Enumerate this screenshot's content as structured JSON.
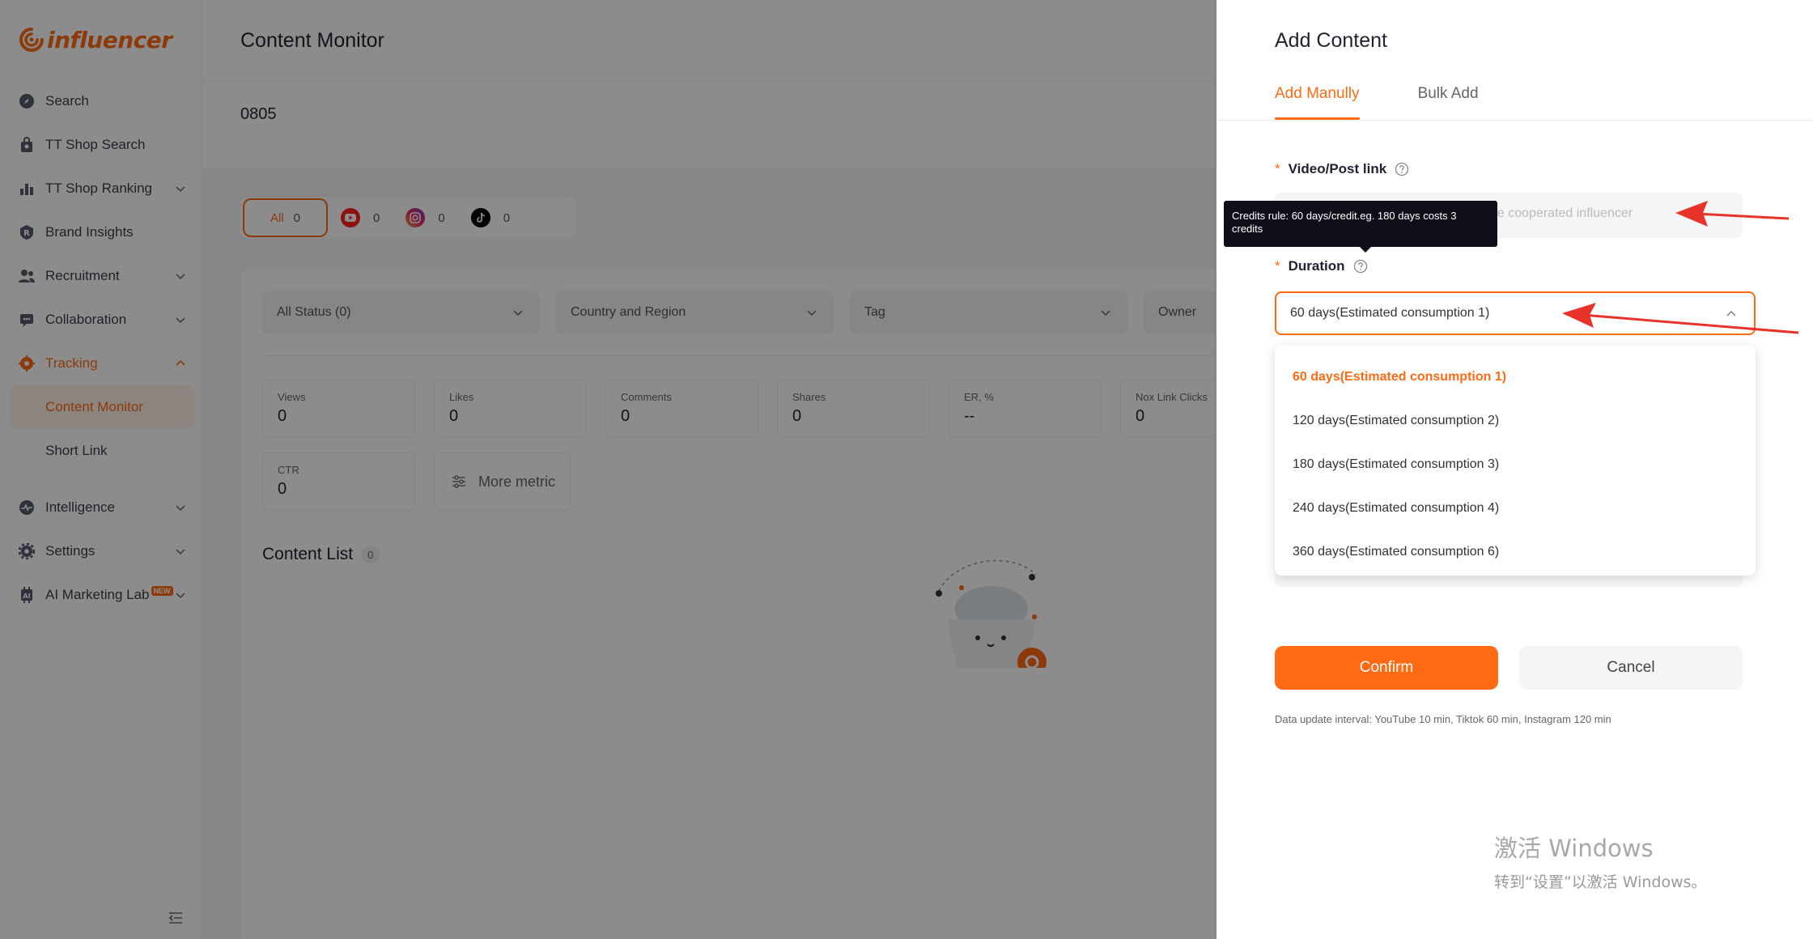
{
  "brand": {
    "logo_text": "influencer",
    "accent": "#ff6a13"
  },
  "sidebar": {
    "items": [
      {
        "label": "Search",
        "icon": "compass-icon"
      },
      {
        "label": "TT Shop Search",
        "icon": "shop-icon"
      },
      {
        "label": "TT Shop Ranking",
        "icon": "bar-chart-icon"
      },
      {
        "label": "Brand Insights",
        "icon": "brand-icon"
      },
      {
        "label": "Recruitment",
        "icon": "people-icon"
      },
      {
        "label": "Collaboration",
        "icon": "collaboration-icon"
      },
      {
        "label": "Tracking",
        "icon": "tracking-icon"
      },
      {
        "label": "Intelligence",
        "icon": "pulse-icon"
      },
      {
        "label": "Settings",
        "icon": "gear-icon"
      },
      {
        "label": "AI Marketing Lab",
        "icon": "ai-icon",
        "badge": "NEW"
      }
    ],
    "sub_items": [
      "Content Monitor",
      "Short Link"
    ]
  },
  "header": {
    "title": "Content Monitor",
    "project": "0805"
  },
  "platform_tabs": [
    {
      "label": "All",
      "count": "0"
    },
    {
      "label": "",
      "count": "0",
      "icon": "youtube-icon"
    },
    {
      "label": "",
      "count": "0",
      "icon": "instagram-icon"
    },
    {
      "label": "",
      "count": "0",
      "icon": "tiktok-icon"
    }
  ],
  "filters": [
    "All Status (0)",
    "Country and Region",
    "Tag",
    "Owner"
  ],
  "metrics": [
    {
      "label": "Views",
      "value": "0"
    },
    {
      "label": "Likes",
      "value": "0"
    },
    {
      "label": "Comments",
      "value": "0"
    },
    {
      "label": "Shares",
      "value": "0"
    },
    {
      "label": "ER, %",
      "value": "--"
    },
    {
      "label": "Nox Link Clicks",
      "value": "0"
    }
  ],
  "ctr": {
    "label": "CTR",
    "value": "0"
  },
  "more_metric": "More metric",
  "content_list": {
    "title": "Content List",
    "count": "0"
  },
  "drawer": {
    "title": "Add Content",
    "tabs": [
      "Add Manully",
      "Bulk Add"
    ],
    "link_label": "Video/Post link",
    "link_placeholder_visible": "he cooperated influencer",
    "tooltip": "Credits rule: 60 days/credit.eg. 180 days costs 3 credits",
    "duration_label": "Duration",
    "duration_value": "60 days(Estimated consumption 1)",
    "options": [
      "60 days(Estimated consumption 1)",
      "120 days(Estimated consumption 2)",
      "180 days(Estimated consumption 3)",
      "240 days(Estimated consumption 4)",
      "360 days(Estimated consumption 6)"
    ],
    "confirm": "Confirm",
    "cancel": "Cancel",
    "note": "Data update interval: YouTube 10 min, Tiktok 60 min, Instagram 120 min"
  },
  "watermark": {
    "line1": "激活 Windows",
    "line2": "转到“设置”以激活 Windows。"
  }
}
